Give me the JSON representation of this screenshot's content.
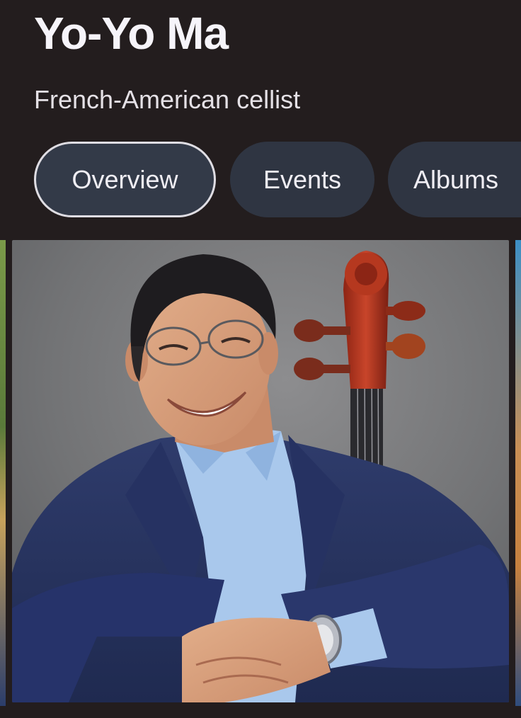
{
  "entity": {
    "name": "Yo-Yo Ma",
    "description": "French-American cellist"
  },
  "tabs": [
    {
      "label": "Overview",
      "selected": true
    },
    {
      "label": "Events",
      "selected": false
    },
    {
      "label": "Albums",
      "selected": false
    }
  ],
  "colors": {
    "background": "#231d1e",
    "chip": "#2f3542",
    "chip_selected_border": "#dfdde3",
    "text": "#f3f0f3"
  }
}
